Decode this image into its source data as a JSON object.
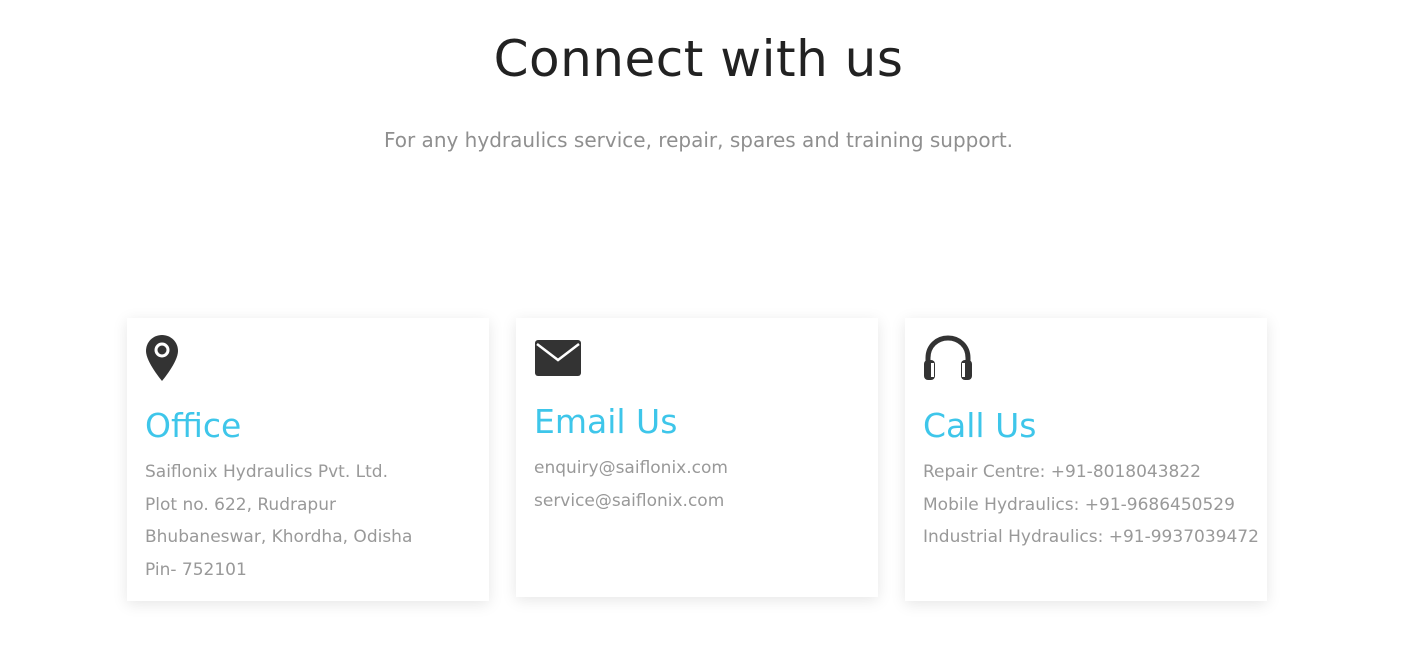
{
  "header": {
    "title": "Connect with us",
    "subtitle": "For any hydraulics service, repair, spares and training support."
  },
  "cards": [
    {
      "icon": "map-pin-icon",
      "title": "Office",
      "lines": [
        "Saiflonix Hydraulics Pvt. Ltd.",
        "Plot no. 622, Rudrapur",
        "Bhubaneswar, Khordha, Odisha",
        "Pin- 752101"
      ]
    },
    {
      "icon": "envelope-icon",
      "title": "Email Us",
      "lines": [
        "enquiry@saiflonix.com",
        "service@saiflonix.com"
      ]
    },
    {
      "icon": "headphones-icon",
      "title": "Call Us",
      "lines": [
        "Repair Centre: +91-8018043822",
        "Mobile Hydraulics: +91-9686450529",
        "Industrial Hydraulics: +91-9937039472"
      ]
    }
  ],
  "colors": {
    "accent": "#3ec6ea",
    "heading": "#222222",
    "muted": "#999999",
    "icon": "#333333"
  }
}
